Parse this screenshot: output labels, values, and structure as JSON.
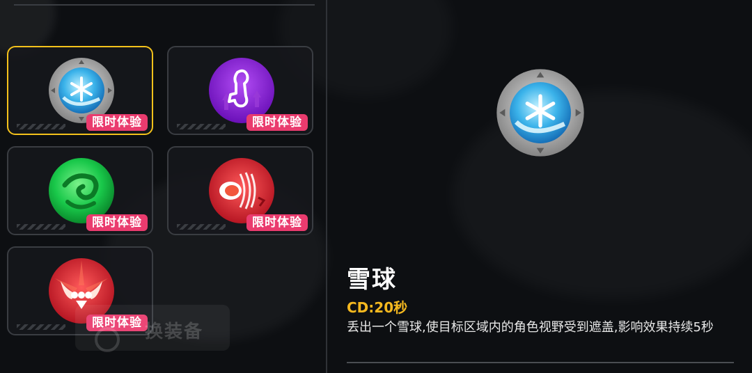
{
  "skills": [
    {
      "id": "snowball",
      "badge": "限时体验",
      "selected": true
    },
    {
      "id": "purple-jump",
      "badge": "限时体验",
      "selected": false
    },
    {
      "id": "green-swirl",
      "badge": "限时体验",
      "selected": false
    },
    {
      "id": "red-dash",
      "badge": "限时体验",
      "selected": false
    },
    {
      "id": "red-wings",
      "badge": "限时体验",
      "selected": false
    }
  ],
  "ghost_button": {
    "label": "换装备"
  },
  "detail": {
    "name": "雪球",
    "cd": "CD:20秒",
    "description": "丢出一个雪球,使目标区域内的角色视野受到遮盖,影响效果持续5秒"
  },
  "colors": {
    "selected_border": "#f4c21b",
    "badge_bg": "#ea3b6e",
    "cd_text": "#f4b81f"
  }
}
